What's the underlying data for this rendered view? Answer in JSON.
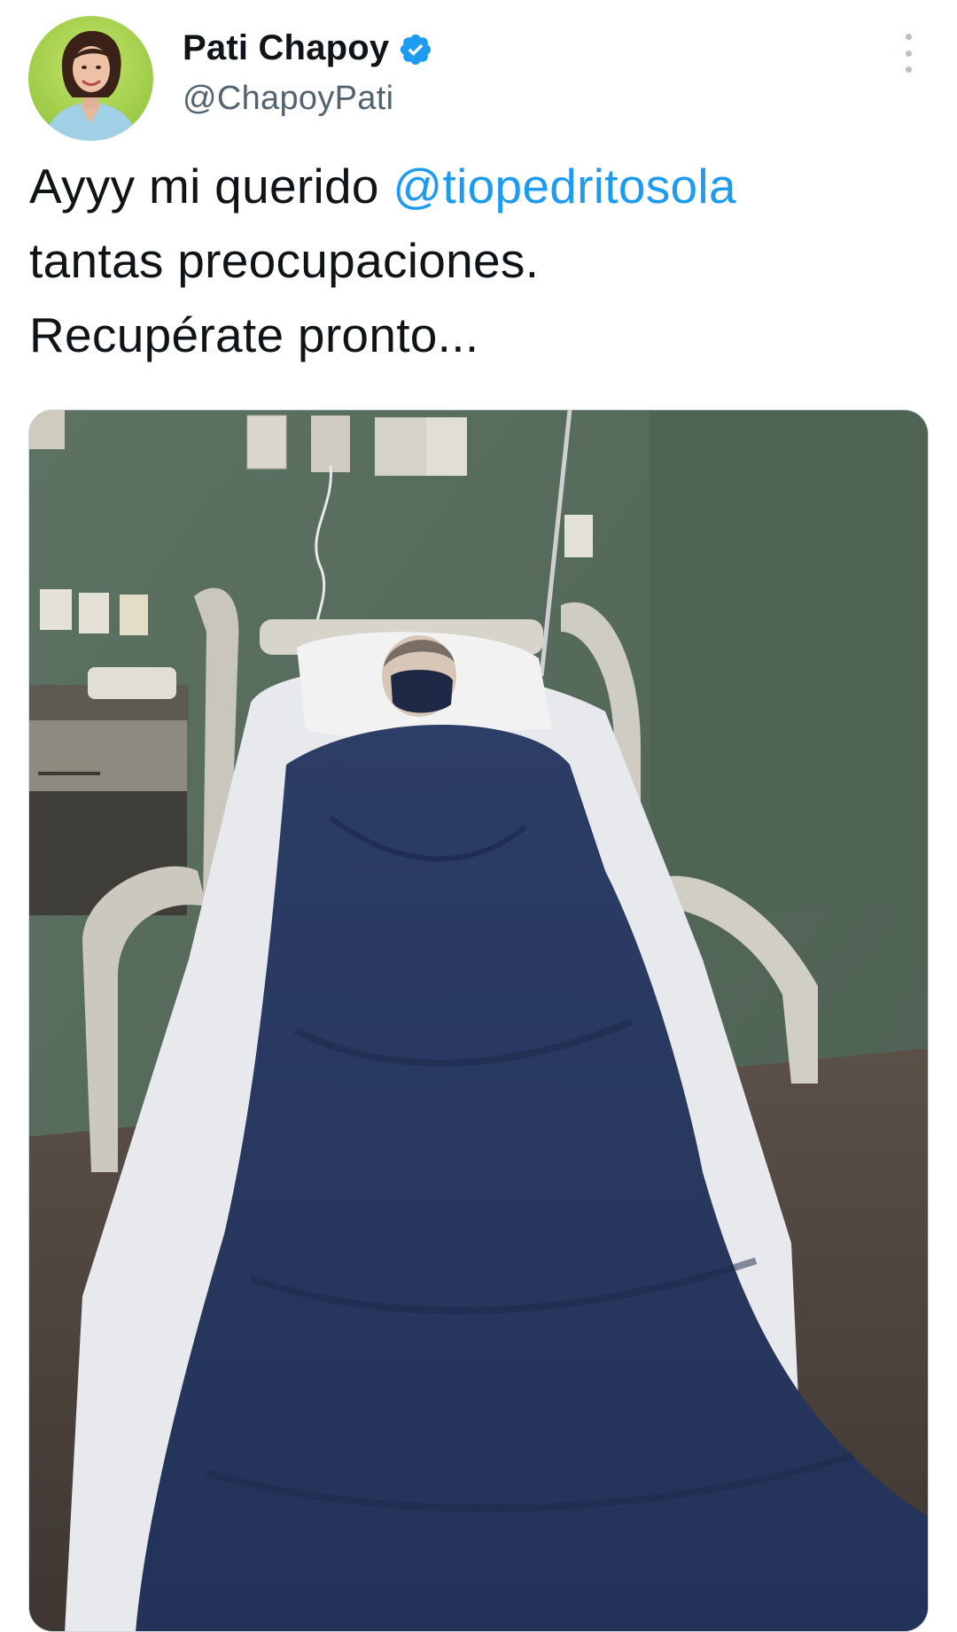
{
  "author": {
    "display_name": "Pati Chapoy",
    "handle": "@ChapoyPati",
    "verified": true,
    "avatar_icon": "profile-photo"
  },
  "tweet": {
    "line1_prefix": "Ayyy mi querido ",
    "mention": "@tiopedritosola",
    "line2": "tantas preocupaciones.",
    "line3": "Recupérate pronto..."
  },
  "media": {
    "description_icon": "photo-attachment"
  },
  "menu": {
    "icon": "more-vertical-icon"
  },
  "colors": {
    "link": "#1d9bf0",
    "text": "#0f1419",
    "secondary": "#536471",
    "verified": "#1d9bf0"
  }
}
